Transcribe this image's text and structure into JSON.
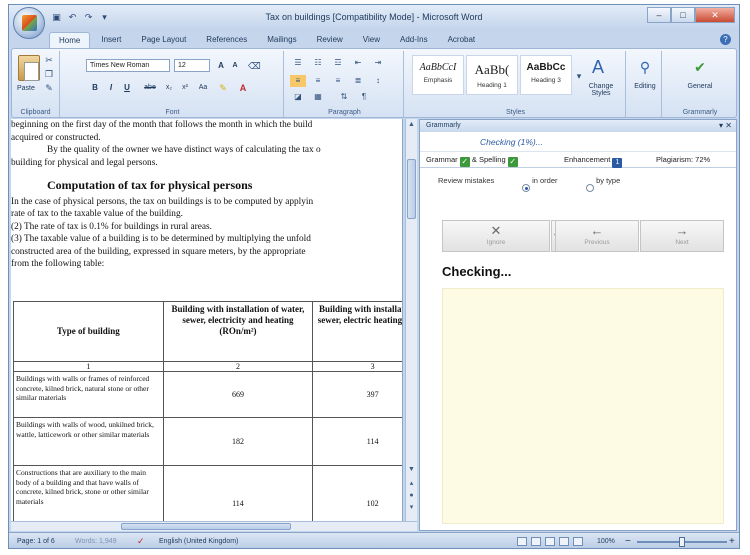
{
  "window": {
    "title": "Tax on buildings [Compatibility Mode] - Microsoft Word",
    "minimize": "–",
    "maximize": "□",
    "close": "✕"
  },
  "tabs": [
    "Home",
    "Insert",
    "Page Layout",
    "References",
    "Mailings",
    "Review",
    "View",
    "Add-Ins",
    "Acrobat"
  ],
  "ribbon": {
    "clipboard": {
      "label": "Clipboard",
      "paste": "Paste"
    },
    "font": {
      "label": "Font",
      "family": "Times New Roman",
      "size": "12",
      "grow": "A",
      "shrink": "A",
      "bold": "B",
      "italic": "I",
      "underline": "U",
      "strike": "abe",
      "subscript": "x₂",
      "superscript": "x²",
      "change_case": "Aa"
    },
    "paragraph": {
      "label": "Paragraph"
    },
    "styles": {
      "label": "Styles",
      "items": [
        {
          "sample": "AaBbCcI",
          "name": "Emphasis"
        },
        {
          "sample": "AaBb(",
          "name": "Heading 1"
        },
        {
          "sample": "AaBbCc",
          "name": "Heading 3"
        }
      ],
      "change_styles": "Change Styles"
    },
    "editing": {
      "label": "Editing"
    },
    "grammarly": {
      "label": "General",
      "group": "Grammarly"
    }
  },
  "document": {
    "lines": [
      "beginning on the first day of the month that follows the month in which the build",
      "acquired or constructed.",
      "By the quality of the owner we have distinct ways of calculating the tax o",
      "building for physical and legal persons."
    ],
    "heading": "Computation of tax for physical persons",
    "body": [
      "In the case of physical persons, the tax on buildings is to be computed by applyin",
      "rate of tax to the taxable value of the building.",
      "(2) The rate of tax is 0.1% for buildings in rural areas.",
      "(3) The taxable value of a building is to be determined by multiplying the unfold",
      "constructed area of the building, expressed in square meters, by the appropriate",
      "from the following table:"
    ],
    "table": {
      "headers": [
        "Type of building",
        "Building with installation of water, sewer, electricity and heating (ROn/m²)",
        "Building with installation of sewer, electric heating (RON"
      ],
      "index_row": [
        "1",
        "2",
        "3"
      ],
      "rows": [
        {
          "desc": "Buildings with walls or frames of reinforced concrete, kilned brick, natural stone or other similar materials",
          "v1": "669",
          "v2": "397"
        },
        {
          "desc": "Buildings with walls of wood, unkilned brick, wattle, latticework or other similar materials",
          "v1": "182",
          "v2": "114"
        },
        {
          "desc": "Constructions that are auxiliary to the main body of a building and that have walls of concrete, kilned brick, stone or other similar materials",
          "v1": "114",
          "v2": "102"
        }
      ]
    }
  },
  "grammarly": {
    "pane_title": "Grammarly",
    "pane_controls": "▾ ✕",
    "status": "Checking (1%)...",
    "tabs": {
      "grammar": "Grammar",
      "spelling": "& Spelling",
      "enhancement": "Enhancement",
      "enhancement_count": "1",
      "plagiarism": "Plagiarism: 72%"
    },
    "review_label": "Review mistakes",
    "review_options": [
      "in order",
      "by type"
    ],
    "buttons": [
      {
        "glyph": "✕",
        "label": "Ignore"
      },
      {
        "glyph": "←",
        "label": "Previous"
      },
      {
        "glyph": "→",
        "label": "Next"
      }
    ],
    "checking_text": "Checking..."
  },
  "statusbar": {
    "page": "Page: 1 of 6",
    "words": "Words: 1,949",
    "language": "English (United Kingdom)",
    "zoom": "100%",
    "zoom_out": "−",
    "zoom_in": "+"
  }
}
